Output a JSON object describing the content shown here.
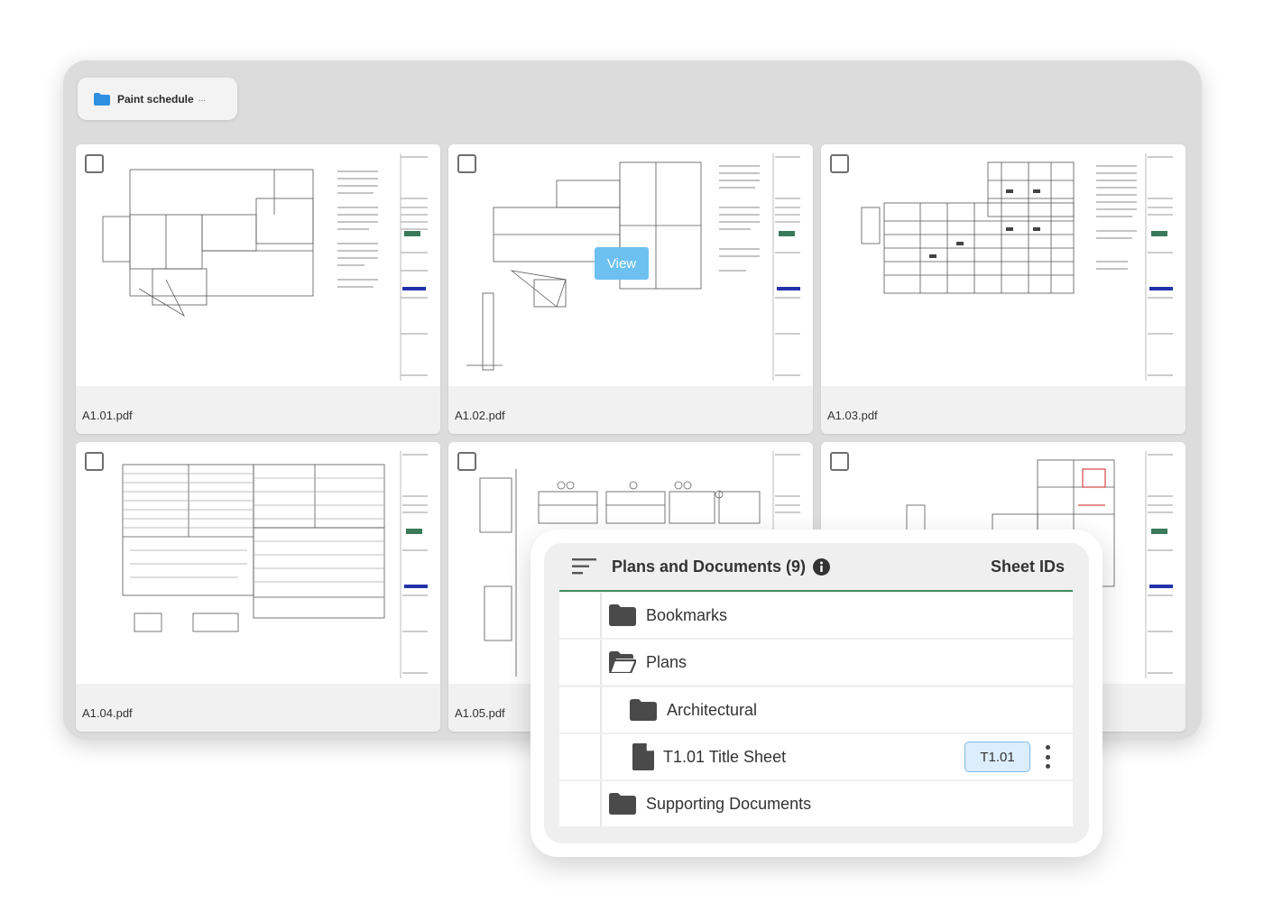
{
  "breadcrumb": {
    "folder_name": "Paint schedule",
    "truncation": "..."
  },
  "documents": [
    {
      "file_name": "A1.01.pdf"
    },
    {
      "file_name": "A1.02.pdf",
      "hover_action": "View"
    },
    {
      "file_name": "A1.03.pdf"
    },
    {
      "file_name": "A1.04.pdf"
    },
    {
      "file_name": "A1.05.pdf"
    },
    {
      "file_name": ""
    }
  ],
  "panel": {
    "title": "Plans and Documents (9)",
    "column_header": "Sheet IDs",
    "rows": [
      {
        "label": "Bookmarks",
        "icon": "folder-icon"
      },
      {
        "label": "Plans",
        "icon": "folder-open-icon"
      },
      {
        "label": "Architectural",
        "icon": "folder-icon"
      },
      {
        "label": "T1.01 Title Sheet",
        "icon": "document-icon",
        "sheet_id": "T1.01"
      },
      {
        "label": "Supporting Documents",
        "icon": "folder-icon"
      }
    ]
  },
  "colors": {
    "accent_blue": "#2e8fe0",
    "view_button": "#6cc1f0",
    "header_rule": "#3f8e5c",
    "badge_bg": "#dceefb"
  }
}
